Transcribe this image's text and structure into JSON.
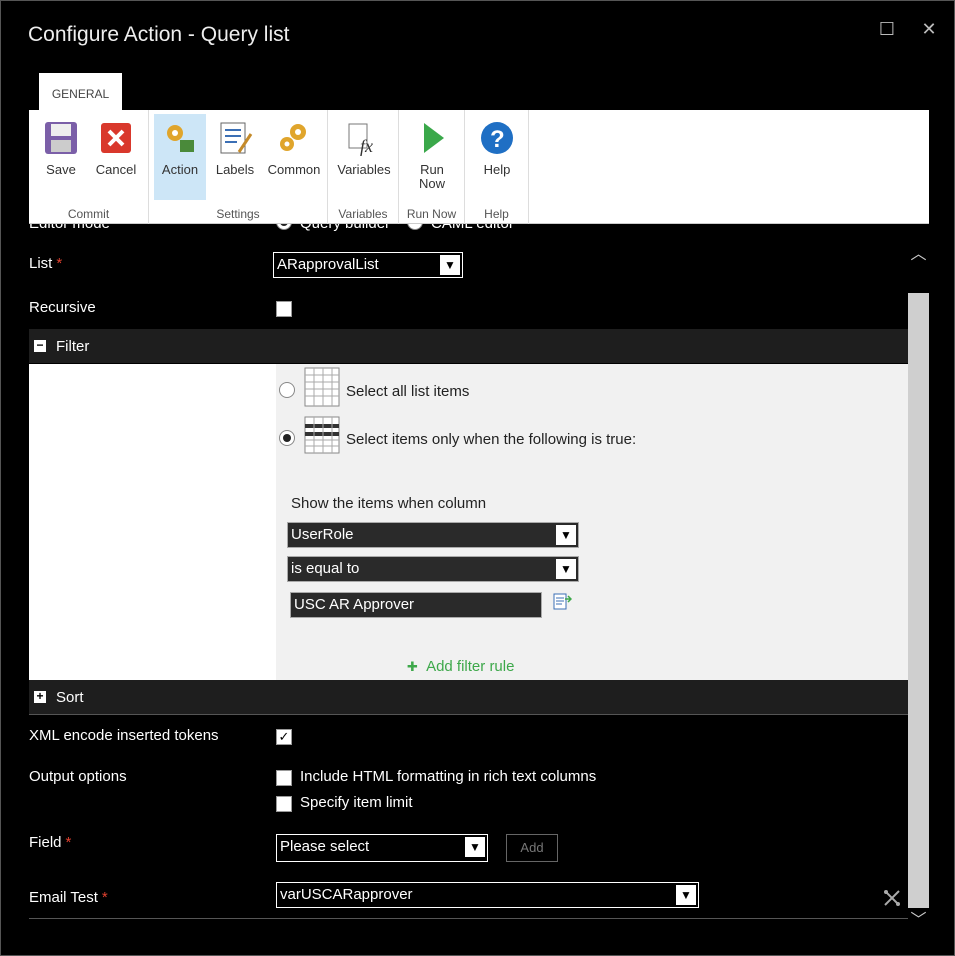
{
  "window": {
    "title": "Configure Action - Query list",
    "maximize_glyph": "☐",
    "close_glyph": "✕"
  },
  "ribbon": {
    "tab": "GENERAL",
    "groups": {
      "commit": {
        "label": "Commit",
        "save": "Save",
        "cancel": "Cancel"
      },
      "settings": {
        "label": "Settings",
        "action": "Action",
        "labels": "Labels",
        "common": "Common"
      },
      "variables": {
        "label": "Variables",
        "variables": "Variables"
      },
      "run_now": {
        "label": "Run Now",
        "run_line1": "Run",
        "run_line2": "Now"
      },
      "help": {
        "label": "Help",
        "help": "Help"
      }
    }
  },
  "form": {
    "editor_mode": {
      "label": "Editor mode",
      "option1": "Query builder",
      "option2": "CAML editor"
    },
    "list": {
      "label": "List",
      "required": "*",
      "value": "ARapprovalList"
    },
    "recursive": {
      "label": "Recursive"
    },
    "filter": {
      "title": "Filter",
      "toggle": "−",
      "option_all": "Select all list items",
      "option_conditional": "Select items only when the following is true:",
      "show_items_label": "Show the items when column",
      "column": "UserRole",
      "operator": "is equal to",
      "value": "USC AR Approver",
      "add_rule": "Add filter rule"
    },
    "sort": {
      "title": "Sort",
      "toggle": "+"
    },
    "xml_encode": {
      "label": "XML encode inserted tokens",
      "check": "✓"
    },
    "output_options": {
      "label": "Output options",
      "include_html": "Include HTML formatting in rich text columns",
      "item_limit": "Specify item limit"
    },
    "field": {
      "label": "Field",
      "required": "*",
      "value": "Please select",
      "add": "Add"
    },
    "email_test": {
      "label": "Email Test",
      "required": "*",
      "value": "varUSCARapprover"
    }
  },
  "icons": {
    "dropdown_arrow": "▼",
    "scroll_up": "︿",
    "scroll_down": "﹀",
    "add_plus": "✚"
  }
}
